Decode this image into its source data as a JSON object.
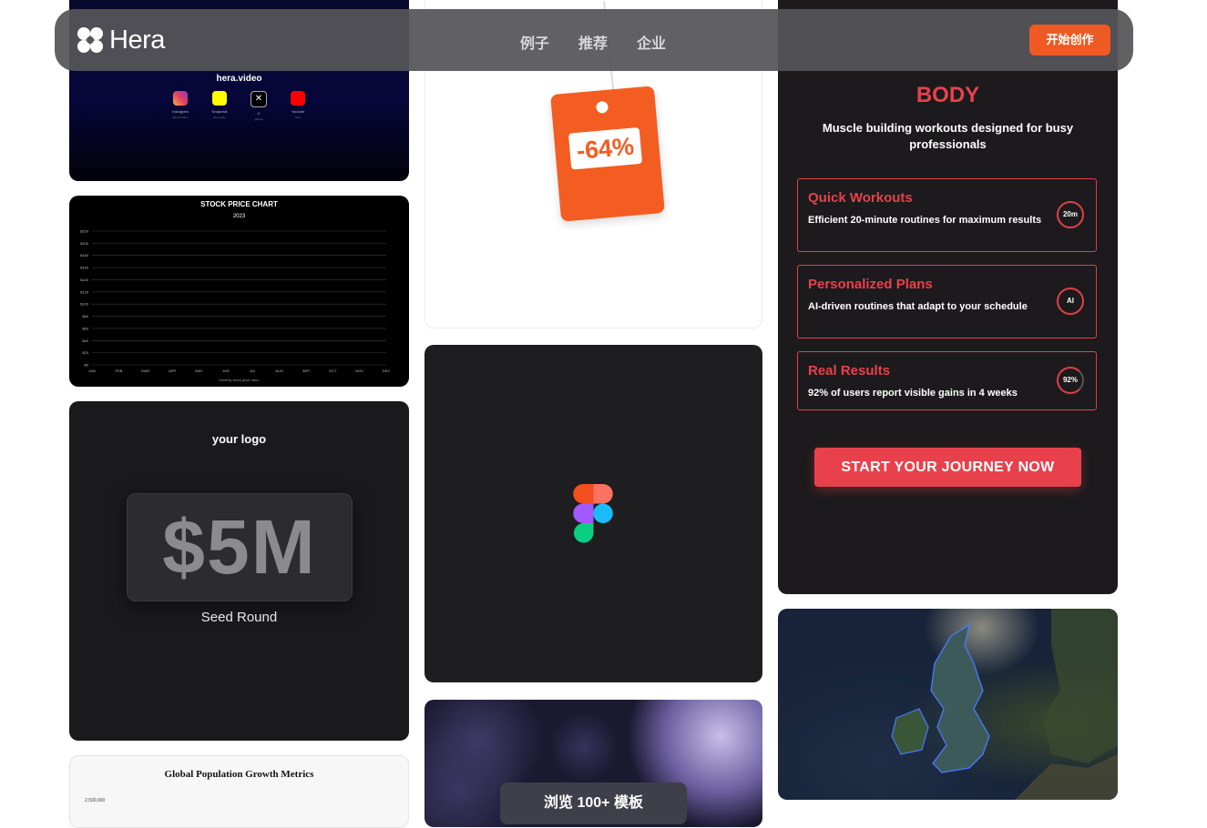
{
  "nav": {
    "brand": "Hera",
    "links": [
      "例子",
      "推荐",
      "企业"
    ],
    "cta": "开始创作"
  },
  "social_card": {
    "site": "hera.video",
    "items": [
      {
        "name": "Instagram",
        "sub": "@hera.video",
        "icon": "instagram-icon"
      },
      {
        "name": "Snapchat",
        "sub": "hera.video",
        "icon": "snapchat-icon"
      },
      {
        "name": "X",
        "sub": "@hera",
        "icon": "x-icon"
      },
      {
        "name": "Youtube",
        "sub": "hera",
        "icon": "youtube-icon"
      }
    ]
  },
  "stock_card": {
    "title": "STOCK PRICE CHART",
    "subtitle": "2023",
    "xlabel": "Monthly stock price data",
    "chart_data": {
      "type": "line",
      "title": "STOCK PRICE CHART",
      "subtitle": "2023",
      "categories": [
        "JAN",
        "FEB",
        "MAR",
        "APR",
        "MAY",
        "JUN",
        "JUL",
        "AUG",
        "SEP",
        "OCT",
        "NOV",
        "DEC"
      ],
      "y_ticks": [
        "$0",
        "$20",
        "$40",
        "$60",
        "$80",
        "$100",
        "$120",
        "$140",
        "$160",
        "$180",
        "$200",
        "$220"
      ],
      "ylim": [
        0,
        220
      ],
      "grid": true,
      "series": []
    }
  },
  "funding_card": {
    "logo": "your logo",
    "amount": "$5M",
    "label": "Seed Round"
  },
  "population_card": {
    "title": "Global Population Growth Metrics",
    "first_tick": "2,500,000"
  },
  "discount_card": {
    "discount": "-64%"
  },
  "figma_card": {
    "icon": "figma-icon"
  },
  "template_card": {
    "button": "浏览 100+ 模板"
  },
  "fitness_card": {
    "title": "BODY",
    "subtitle": "Muscle building workouts designed for busy professionals",
    "features": [
      {
        "title": "Quick Workouts",
        "desc": "Efficient 20-minute routines for maximum results",
        "badge": "20m"
      },
      {
        "title": "Personalized Plans",
        "desc": "AI-driven routines that adapt to your schedule",
        "badge": "AI"
      },
      {
        "title": "Real Results",
        "desc": "92% of users report visible gains in 4 weeks",
        "badge": "92%"
      }
    ],
    "cta": "START YOUR JOURNEY NOW",
    "accent": "#e8414c"
  },
  "map_card": {
    "region": "uk-map"
  },
  "colors": {
    "brand_orange": "#ee5a22",
    "accent_red": "#e8414c"
  }
}
